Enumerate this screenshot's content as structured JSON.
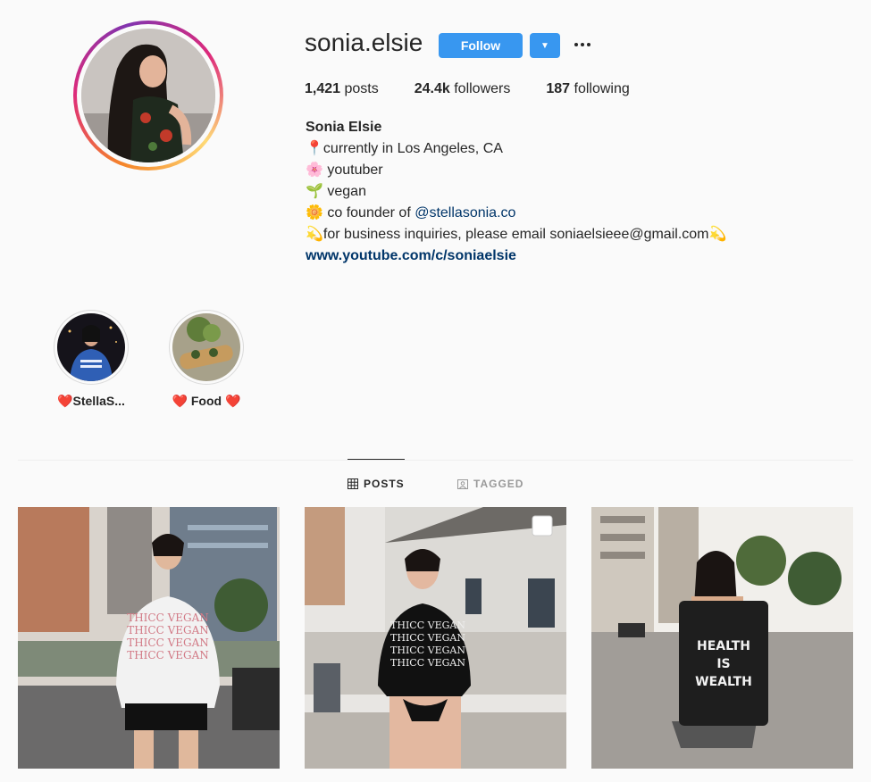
{
  "profile": {
    "username": "sonia.elsie",
    "follow_label": "Follow",
    "dropdown_icon": "▼",
    "more_icon": "more-horizontal-icon",
    "accent_color": "#3897f0",
    "story_ring_colors": [
      "#f58529",
      "#dd2a7b",
      "#8134af"
    ]
  },
  "stats": {
    "posts_count": "1,421",
    "posts_label": " posts",
    "followers_count": "24.4k",
    "followers_label": " followers",
    "following_count": "187",
    "following_label": " following"
  },
  "bio": {
    "name": "Sonia Elsie",
    "line1_emoji": "📍",
    "line1": "currently in Los Angeles, CA",
    "line2_emoji": "🌸",
    "line2": " youtuber",
    "line3_emoji": "🌱",
    "line3": " vegan",
    "line4_emoji": "🌼",
    "line4_prefix": " co founder of ",
    "line4_mention": "@stellasonia.co",
    "line5_emoji_start": "💫",
    "line5": "for business inquiries, please email soniaelsieee@gmail.com",
    "line5_emoji_end": "💫",
    "website": "www.youtube.com/c/soniaelsie"
  },
  "highlights": [
    {
      "label": "❤️StellaS..."
    },
    {
      "label": "❤️ Food ❤️"
    }
  ],
  "tabs": {
    "posts": "POSTS",
    "tagged": "TAGGED"
  },
  "posts": [
    {
      "shirt_text": "THICC VEGAN"
    },
    {
      "shirt_text": "THICC VEGAN"
    },
    {
      "bag_line1": "HEALTH",
      "bag_line2": "IS",
      "bag_line3": "WEALTH"
    }
  ]
}
